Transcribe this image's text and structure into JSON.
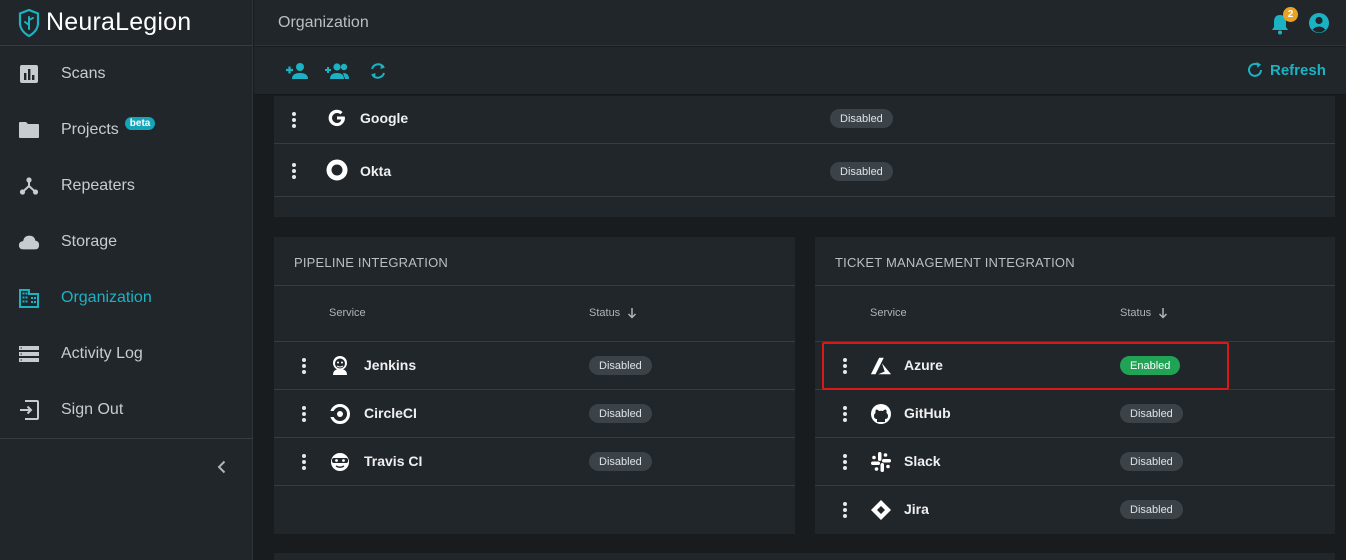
{
  "app": {
    "name": "NeuraLegion"
  },
  "sidebar": {
    "items": [
      {
        "label": "Scans",
        "icon": "chart-box-icon"
      },
      {
        "label": "Projects",
        "icon": "folder-icon",
        "badge": "beta"
      },
      {
        "label": "Repeaters",
        "icon": "network-icon"
      },
      {
        "label": "Storage",
        "icon": "cloud-icon"
      },
      {
        "label": "Organization",
        "icon": "building-icon",
        "active": true
      },
      {
        "label": "Activity Log",
        "icon": "list-icon"
      },
      {
        "label": "Sign Out",
        "icon": "sign-out-icon"
      }
    ]
  },
  "header": {
    "title": "Organization",
    "notifications_count": "2"
  },
  "toolbar": {
    "refresh_label": "Refresh"
  },
  "auth_providers": {
    "rows": [
      {
        "name": "Google",
        "status": "Disabled"
      },
      {
        "name": "Okta",
        "status": "Disabled"
      }
    ]
  },
  "pipeline": {
    "title": "PIPELINE INTEGRATION",
    "col_service": "Service",
    "col_status": "Status",
    "rows": [
      {
        "name": "Jenkins",
        "status": "Disabled"
      },
      {
        "name": "CircleCI",
        "status": "Disabled"
      },
      {
        "name": "Travis CI",
        "status": "Disabled"
      }
    ]
  },
  "ticket": {
    "title": "TICKET MANAGEMENT INTEGRATION",
    "col_service": "Service",
    "col_status": "Status",
    "rows": [
      {
        "name": "Azure",
        "status": "Enabled"
      },
      {
        "name": "GitHub",
        "status": "Disabled"
      },
      {
        "name": "Slack",
        "status": "Disabled"
      },
      {
        "name": "Jira",
        "status": "Disabled"
      }
    ]
  },
  "colors": {
    "accent": "#1bb3c4",
    "enabled": "#21a356",
    "badge": "#e8a324",
    "highlight": "#d91818"
  }
}
